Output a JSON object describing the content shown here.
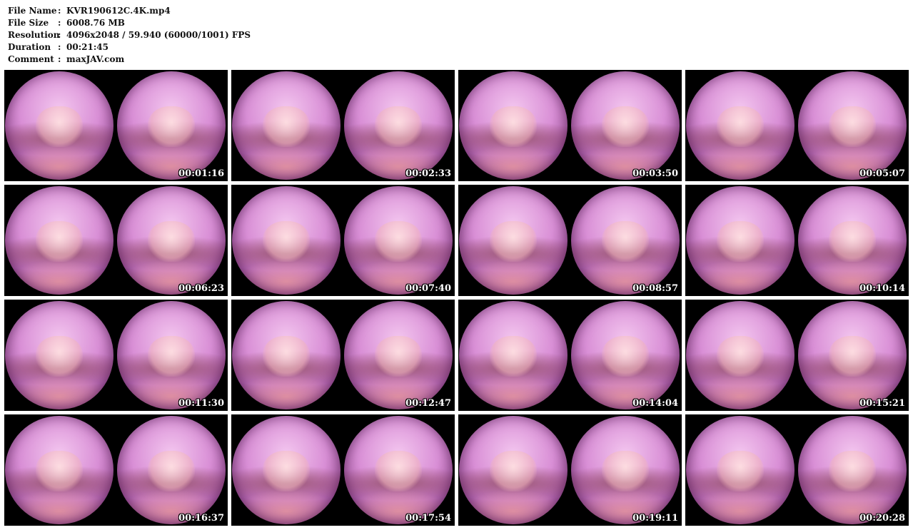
{
  "info": {
    "file_name_label": "File Name",
    "file_name": "KVR190612C.4K.mp4",
    "file_size_label": "File Size",
    "file_size": "6008.76 MB",
    "resolution_label": "Resolution",
    "resolution": "4096x2048 / 59.940 (60000/1001) FPS",
    "duration_label": "Duration",
    "duration": "00:21:45",
    "comment_label": "Comment",
    "comment": "maxJAV.com",
    "separator": ":"
  },
  "thumbnails": [
    {
      "time": "00:01:16"
    },
    {
      "time": "00:02:33"
    },
    {
      "time": "00:03:50"
    },
    {
      "time": "00:05:07"
    },
    {
      "time": "00:06:23"
    },
    {
      "time": "00:07:40"
    },
    {
      "time": "00:08:57"
    },
    {
      "time": "00:10:14"
    },
    {
      "time": "00:11:30"
    },
    {
      "time": "00:12:47"
    },
    {
      "time": "00:14:04"
    },
    {
      "time": "00:15:21"
    },
    {
      "time": "00:16:37"
    },
    {
      "time": "00:17:54"
    },
    {
      "time": "00:19:11"
    },
    {
      "time": "00:20:28"
    }
  ]
}
